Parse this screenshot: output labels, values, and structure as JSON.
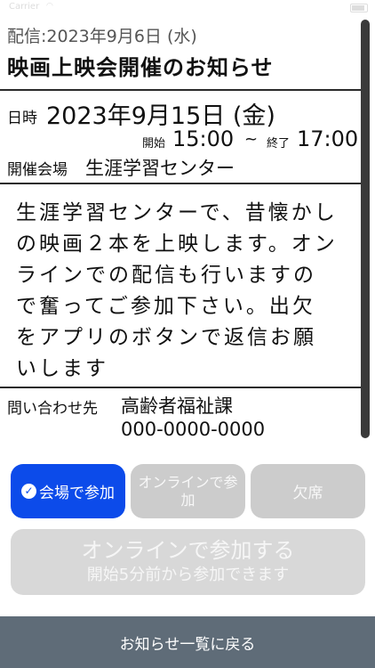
{
  "notice": {
    "posted_date": "配信:2023年9月6日 (水)",
    "title": "映画上映会開催のお知らせ",
    "date_label": "日時",
    "event_date": "2023年9月15日 (金)",
    "start_label": "開始",
    "start_time": "15:00",
    "time_separator": "~",
    "end_label": "終了",
    "end_time": "17:00",
    "venue_label": "開催会場",
    "venue": "生涯学習センター",
    "body": "生涯学習センターで、昔懐かしの映画２本を上映します。オンラインでの配信も行いますので奮ってご参加下さい。出欠をアプリのボタンで返信お願いします",
    "contact_label": "問い合わせ先",
    "contact_department": "高齢者福祉課",
    "contact_phone": "000-0000-0000"
  },
  "actions": {
    "venue_label": "会場で参加",
    "venue_selected": true,
    "online_label": "オンラインで参加",
    "absent_label": "欠席",
    "join_online_label": "オンラインで参加する",
    "join_online_note": "開始5分前から参加できます"
  },
  "footer": {
    "back_label": "お知らせ一覧に戻る"
  },
  "colors": {
    "selected_button": "#0c4bea",
    "disabled_button": "#cccccc",
    "bottom_bar": "#5f6c78"
  }
}
